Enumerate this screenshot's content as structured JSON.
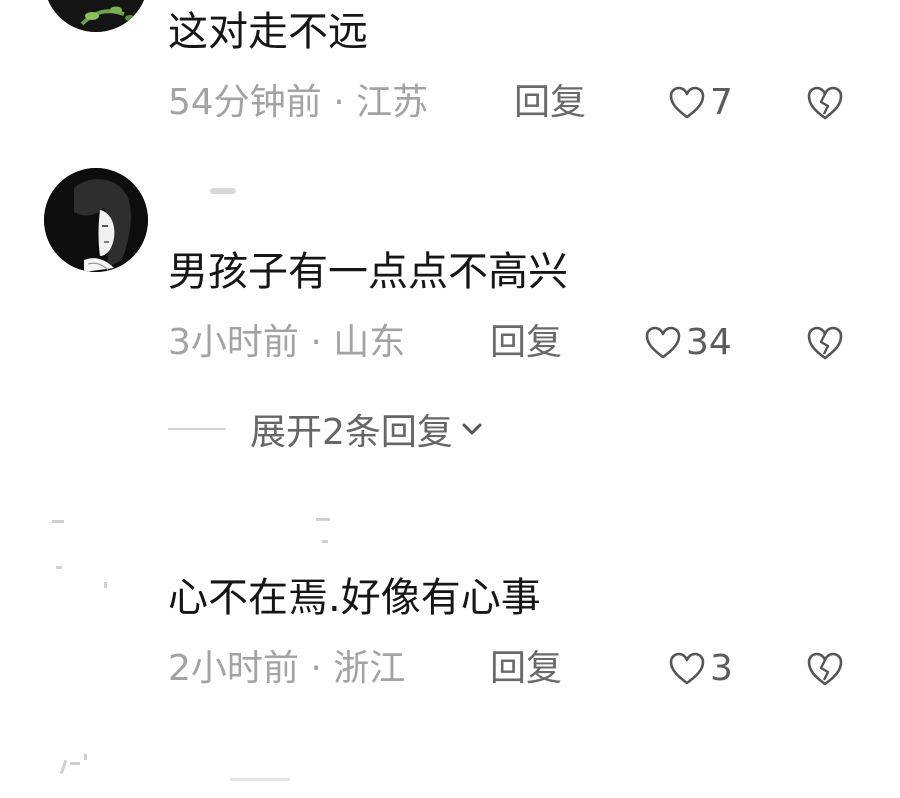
{
  "comments": [
    {
      "text": "这对走不远",
      "time_location": "54分钟前 · 江苏",
      "reply_label": "回复",
      "likes": "7"
    },
    {
      "text": "男孩子有一点点不高兴",
      "time_location": "3小时前 · 山东",
      "reply_label": "回复",
      "likes": "34",
      "expand_label": "展开2条回复"
    },
    {
      "text": "心不在焉.好像有心事",
      "time_location": "2小时前 · 浙江",
      "reply_label": "回复",
      "likes": "3"
    }
  ],
  "icons": {
    "like": "heart-outline-icon",
    "dislike": "broken-heart-icon",
    "expand": "chevron-down-icon"
  },
  "colors": {
    "text": "#161616",
    "meta": "#a3a3a3",
    "reply": "#6a6a6a"
  }
}
